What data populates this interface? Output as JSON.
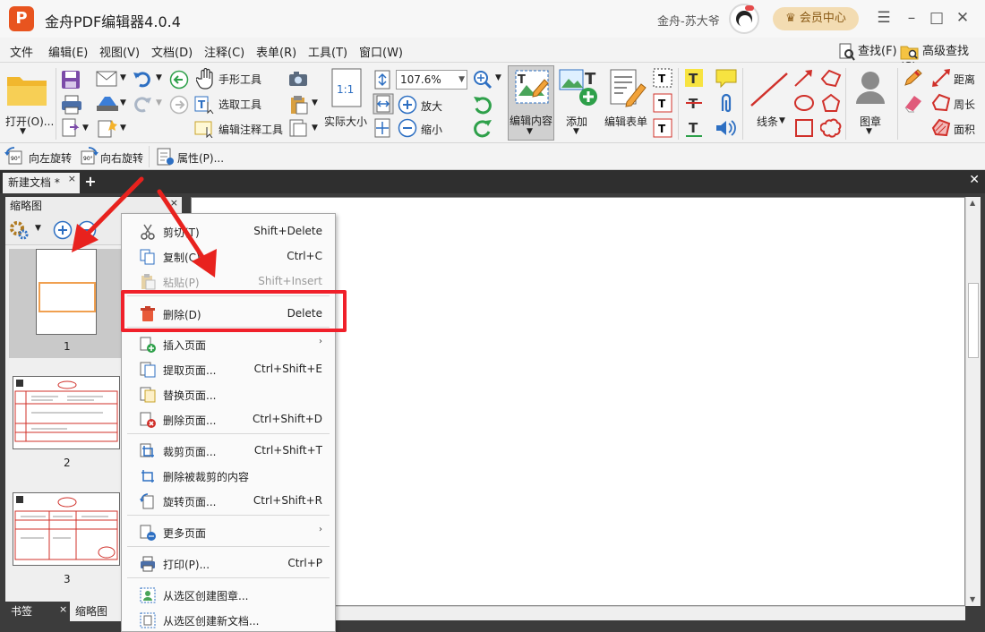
{
  "app": {
    "logo": "P",
    "title": "金舟PDF编辑器4.0.4",
    "user": "金舟-苏大爷",
    "vip_button": "会员中心"
  },
  "window": {
    "menu_icon": "☰",
    "minimize_icon": "–",
    "maximize_icon": "□",
    "close_icon": "✕"
  },
  "menubar": {
    "items": [
      "文件",
      "编辑(E)",
      "视图(V)",
      "文档(D)",
      "注释(C)",
      "表单(R)",
      "工具(T)",
      "窗口(W)"
    ],
    "find": "查找(F)",
    "advanced_find": "高级查找(S)"
  },
  "ribbon": {
    "open": "打开(O)...",
    "hand_tool": "手形工具",
    "select_tool": "选取工具",
    "edit_annotation_tool": "编辑注释工具",
    "actual_size": "实际大小",
    "zoom_value": "107.6%",
    "zoom_in": "放大",
    "zoom_out": "缩小",
    "edit_content": "编辑内容",
    "add": "添加",
    "edit_form": "编辑表单",
    "line": "线条",
    "stamp": "图章",
    "distance": "距离",
    "perimeter": "周长",
    "area": "面积"
  },
  "toolbar2": {
    "rotate_left": "向左旋转",
    "rotate_right": "向右旋转",
    "properties": "属性(P)..."
  },
  "doc_tab": {
    "name": "新建文档 *",
    "close": "×",
    "plus": "+",
    "close_all": "✕"
  },
  "panel": {
    "title": "缩略图",
    "close": "×",
    "pages": [
      "1",
      "2",
      "3"
    ],
    "bottom_tabs": [
      "书签",
      "缩略图"
    ],
    "bookmark_close": "×"
  },
  "context_menu": {
    "items": [
      {
        "label": "剪切(T)",
        "shortcut": "Shift+Delete"
      },
      {
        "label": "复制(C)",
        "shortcut": "Ctrl+C"
      },
      {
        "label": "粘贴(P)",
        "shortcut": "Shift+Insert"
      },
      {
        "label": "删除(D)",
        "shortcut": "Delete"
      },
      {
        "label": "插入页面",
        "shortcut": ""
      },
      {
        "label": "提取页面...",
        "shortcut": "Ctrl+Shift+E"
      },
      {
        "label": "替换页面...",
        "shortcut": ""
      },
      {
        "label": "删除页面...",
        "shortcut": "Ctrl+Shift+D"
      },
      {
        "label": "裁剪页面...",
        "shortcut": "Ctrl+Shift+T"
      },
      {
        "label": "删除被裁剪的内容",
        "shortcut": ""
      },
      {
        "label": "旋转页面...",
        "shortcut": "Ctrl+Shift+R"
      },
      {
        "label": "更多页面",
        "shortcut": ""
      },
      {
        "label": "打印(P)...",
        "shortcut": "Ctrl+P"
      },
      {
        "label": "从选区创建图章...",
        "shortcut": ""
      },
      {
        "label": "从选区创建新文档...",
        "shortcut": ""
      }
    ],
    "submenu_arrow": "›"
  },
  "colors": {
    "accent": "#e8541f",
    "highlight": "#f0202a",
    "dark_bg": "#3c3c3c"
  }
}
